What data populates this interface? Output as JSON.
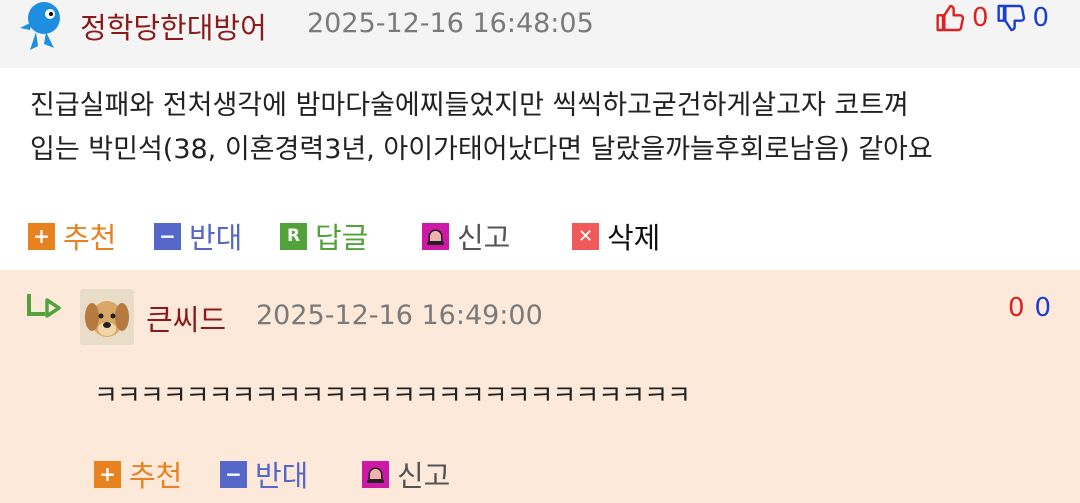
{
  "comments": [
    {
      "nickname": "정학당한대방어",
      "datetime": "2025-12-16 16:48:05",
      "upvotes": "0",
      "downvotes": "0",
      "text_lines": [
        "진급실패와 전처생각에 밤마다술에찌들었지만 씩씩하고굳건하게살고자 코트껴",
        "입는 박민석(38, 이혼경력3년, 아이가태어났다면 달랐을까늘후회로남음) 같아요"
      ],
      "actions": {
        "recommend": "추천",
        "oppose": "반대",
        "reply": "답글",
        "report": "신고",
        "delete": "삭제"
      },
      "action_icons": {
        "recommend": "plus-icon",
        "oppose": "minus-icon",
        "reply": "reply-r-icon",
        "report": "siren-icon",
        "delete": "x-icon"
      }
    },
    {
      "nickname": "큰씨드",
      "datetime": "2025-12-16 16:49:00",
      "upvotes": "0",
      "downvotes": "0",
      "text": "ㅋㅋㅋㅋㅋㅋㅋㅋㅋㅋㅋㅋㅋㅋㅋㅋㅋㅋㅋㅋㅋㅋㅋㅋㅋㅋ",
      "actions": {
        "recommend": "추천",
        "oppose": "반대",
        "report": "신고"
      }
    }
  ],
  "colors": {
    "nickname": "#8b1a1a",
    "recommend": "#e8821e",
    "oppose": "#5567c9",
    "reply": "#52a23b",
    "report_icon": "#cc1aa6",
    "delete_icon": "#f05a5a",
    "reply_bg": "#fde9d9",
    "header_bg": "#f4f4f4"
  }
}
